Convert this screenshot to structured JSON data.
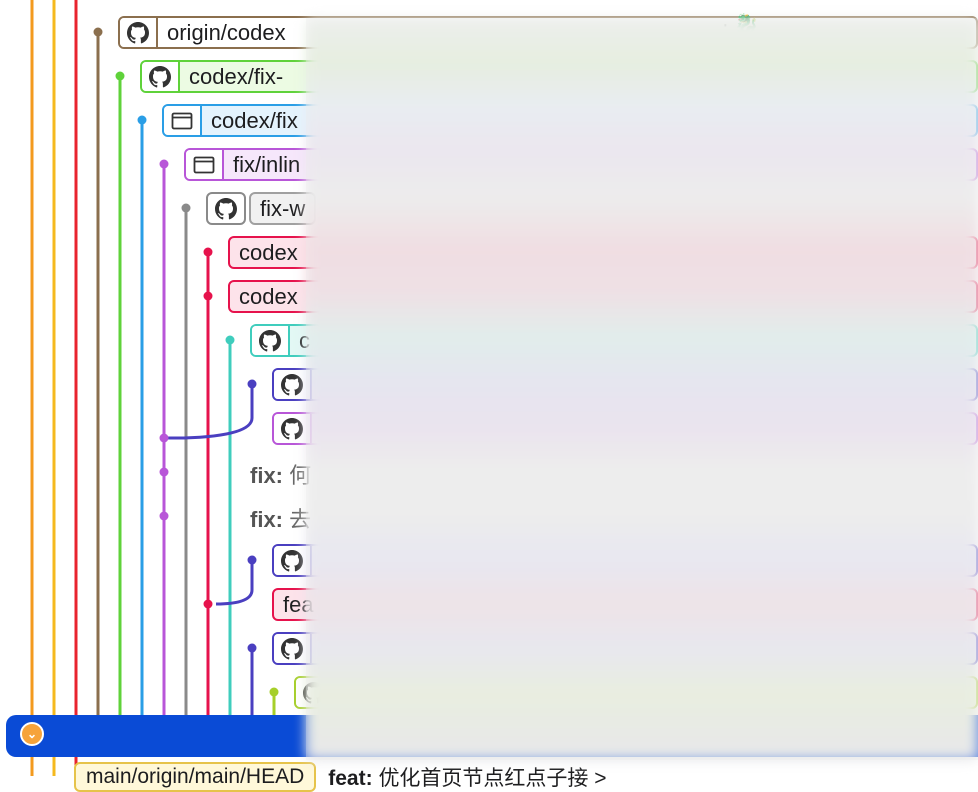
{
  "refs": [
    {
      "id": "r0",
      "label": "origin/codex",
      "kind": "github",
      "color": "#8b6f4e",
      "fill": "#ffffff",
      "row": 0
    },
    {
      "id": "r1",
      "label": "codex/fix-",
      "kind": "github",
      "color": "#5fd23a",
      "fill": "#ecfbe3",
      "row": 1
    },
    {
      "id": "r2",
      "label": "codex/fix",
      "kind": "folder",
      "color": "#2a9ee6",
      "fill": "#e4f3fd",
      "row": 2
    },
    {
      "id": "r3",
      "label": "fix/inlin",
      "kind": "folder",
      "color": "#b856d8",
      "fill": "#f6e7fb",
      "row": 3
    },
    {
      "id": "r4",
      "label": "fix-w",
      "kind": "github-split",
      "color": "#8a8a8a",
      "fill": "#f1f1f1",
      "row": 4
    },
    {
      "id": "r5",
      "label": "codex",
      "kind": "plain",
      "color": "#e6124c",
      "fill": "#fde3ea",
      "row": 5
    },
    {
      "id": "r6",
      "label": "codex",
      "kind": "plain",
      "color": "#e6124c",
      "fill": "#fde3ea",
      "row": 6
    },
    {
      "id": "r7",
      "label": "c",
      "kind": "github",
      "color": "#3fcdbd",
      "fill": "#e3f8f5",
      "row": 7
    },
    {
      "id": "r8",
      "label": "",
      "kind": "github",
      "color": "#4a3fc0",
      "fill": "#eceaf8",
      "row": 8
    },
    {
      "id": "r9",
      "label": "",
      "kind": "github",
      "color": "#b856d8",
      "fill": "#f6e7fb",
      "row": 9
    },
    {
      "id": "r12",
      "label": "",
      "kind": "github",
      "color": "#4a3fc0",
      "fill": "#eceaf8",
      "row": 12
    },
    {
      "id": "r13",
      "label": "fea",
      "kind": "plain",
      "color": "#e6124c",
      "fill": "#fde3ea",
      "row": 13
    },
    {
      "id": "r14",
      "label": "",
      "kind": "github",
      "color": "#4a3fc0",
      "fill": "#eceaf8",
      "row": 14
    },
    {
      "id": "r15",
      "label": "",
      "kind": "github",
      "color": "#a6cf2a",
      "fill": "#f5fbe3",
      "row": 15
    }
  ],
  "messages": [
    {
      "prefix": "fix:",
      "text": "何",
      "row": 10
    },
    {
      "prefix": "fix:",
      "text": "去",
      "row": 11
    }
  ],
  "top_extra": "· 🐉",
  "bottom": {
    "ref_label": "main/origin/main/HEAD",
    "msg_prefix": "feat:",
    "msg_text": "优化首页节点红点子接 >"
  },
  "head_toggle_icon": "chevron-down-icon",
  "lanes": {
    "colors": [
      "#f39a1e",
      "#f5b91e",
      "#e8242f",
      "#8b6f4e",
      "#5fd23a",
      "#2a9ee6",
      "#b856d8",
      "#8a8a8a",
      "#e6124c",
      "#3fcdbd",
      "#4a3fc0",
      "#a6cf2a"
    ]
  }
}
